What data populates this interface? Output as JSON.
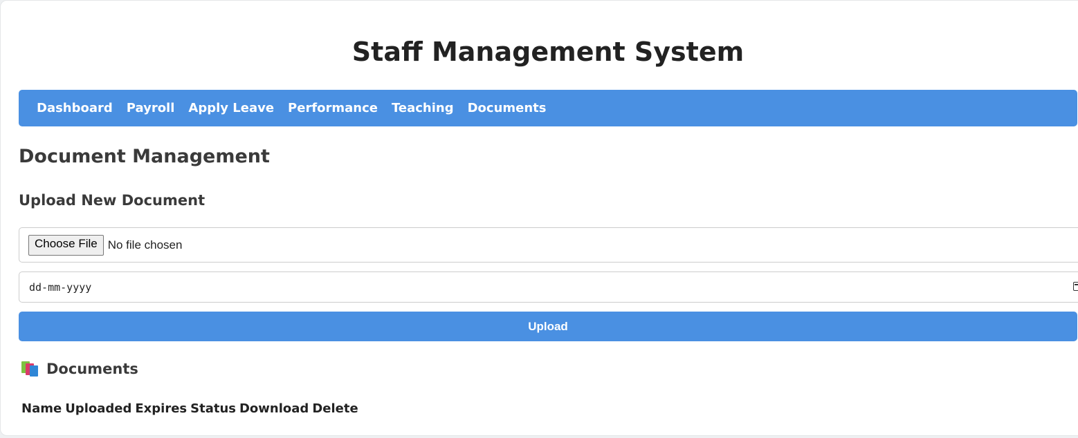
{
  "app": {
    "title": "Staff Management System"
  },
  "nav": {
    "items": [
      "Dashboard",
      "Payroll",
      "Apply Leave",
      "Performance",
      "Teaching",
      "Documents"
    ]
  },
  "page": {
    "title": "Document Management",
    "upload_section_title": "Upload New Document"
  },
  "upload_form": {
    "choose_file_label": "Choose File",
    "file_status": "No file chosen",
    "date_placeholder": "dd-mm-yyyy",
    "submit_label": "Upload"
  },
  "documents": {
    "heading": "Documents",
    "heading_icon": "books-icon",
    "columns": [
      "Name",
      "Uploaded",
      "Expires",
      "Status",
      "Download",
      "Delete"
    ],
    "rows": []
  },
  "colors": {
    "accent": "#4a90e2",
    "text": "#333333"
  }
}
